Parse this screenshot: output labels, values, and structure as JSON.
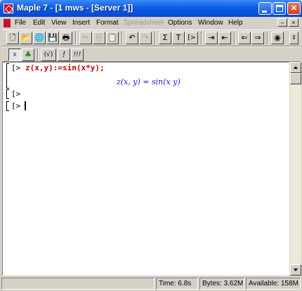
{
  "window": {
    "title": "Maple 7 - [1 mws - [Server 1]]",
    "controls": {
      "minimize": "_",
      "maximize": "□",
      "close": "✕"
    }
  },
  "menubar": {
    "items": [
      {
        "label": "File",
        "disabled": false
      },
      {
        "label": "Edit",
        "disabled": false
      },
      {
        "label": "View",
        "disabled": false
      },
      {
        "label": "Insert",
        "disabled": false
      },
      {
        "label": "Format",
        "disabled": false
      },
      {
        "label": "Spreadsheet",
        "disabled": true
      },
      {
        "label": "Options",
        "disabled": false
      },
      {
        "label": "Window",
        "disabled": false
      },
      {
        "label": "Help",
        "disabled": false
      }
    ],
    "doc_controls": {
      "minimize": "–",
      "close": "×"
    }
  },
  "toolbar1": {
    "buttons": [
      {
        "name": "new-document-icon",
        "glyph": "🗋"
      },
      {
        "name": "open-icon",
        "glyph": "📂"
      },
      {
        "name": "open-url-icon",
        "glyph": "🌐"
      },
      {
        "name": "save-icon",
        "glyph": "💾"
      },
      {
        "name": "print-icon",
        "glyph": "🖶"
      },
      {
        "name": "cut-icon",
        "glyph": "✂"
      },
      {
        "name": "copy-icon",
        "glyph": "⎘"
      },
      {
        "name": "paste-icon",
        "glyph": "📋"
      },
      {
        "name": "undo-icon",
        "glyph": "↶"
      },
      {
        "name": "redo-icon",
        "glyph": "↷"
      },
      {
        "name": "sigma-icon",
        "glyph": "Σ"
      },
      {
        "name": "text-icon",
        "glyph": "T"
      },
      {
        "name": "maple-input-icon",
        "glyph": "[>"
      },
      {
        "name": "indent-icon",
        "glyph": "⇥"
      },
      {
        "name": "outdent-icon",
        "glyph": "⇤"
      },
      {
        "name": "arrow-back-icon",
        "glyph": "⇐"
      },
      {
        "name": "arrow-forward-icon",
        "glyph": "⇒"
      },
      {
        "name": "stop-icon",
        "glyph": "◉"
      }
    ]
  },
  "toolbar2": {
    "buttons": [
      {
        "name": "exec-mode-icon",
        "glyph": "x"
      },
      {
        "name": "maple-leaf-icon",
        "glyph": "♣"
      },
      {
        "name": "check-syntax-icon",
        "glyph": "(√)"
      },
      {
        "name": "execute-icon",
        "glyph": "!"
      },
      {
        "name": "execute-all-icon",
        "glyph": "!!!"
      }
    ]
  },
  "worksheet": {
    "prompt": "[>",
    "input": "z(x,y):=sin(x*y);",
    "output": "z(x, y) = sin(x y)",
    "empty_prompts": [
      "[>",
      "[>"
    ]
  },
  "statusbar": {
    "time": "Time: 6.8s",
    "bytes": "Bytes: 3.62M",
    "available": "Available: 158M"
  },
  "colors": {
    "titlebar": "#0a5ce6",
    "input_text": "#c00000",
    "output_text": "#1a1ac8"
  }
}
